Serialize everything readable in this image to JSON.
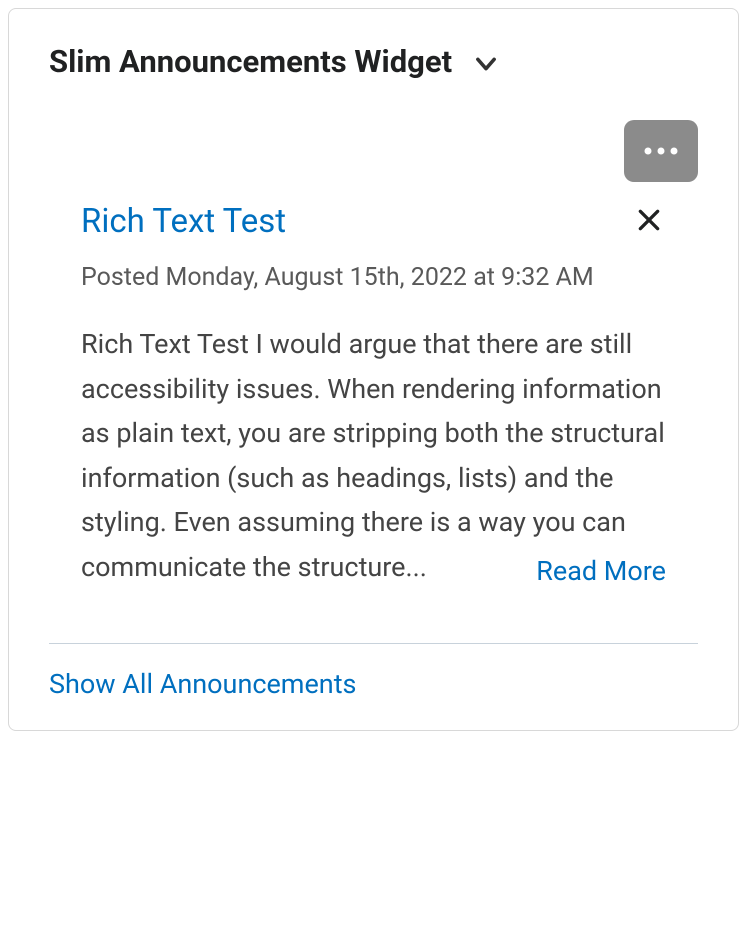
{
  "widget": {
    "title": "Slim Announcements Widget"
  },
  "announcement": {
    "title": "Rich Text Test",
    "posted": "Posted Monday, August 15th, 2022 at 9:32 AM",
    "body": "Rich Text Test I would argue that there are still accessibility issues. When rendering information as plain text, you are stripping both the structural information (such as headings, lists) and the styling. Even assuming there is a way you can communicate the structure...",
    "read_more_label": "Read More"
  },
  "footer": {
    "show_all_label": "Show All Announcements"
  }
}
